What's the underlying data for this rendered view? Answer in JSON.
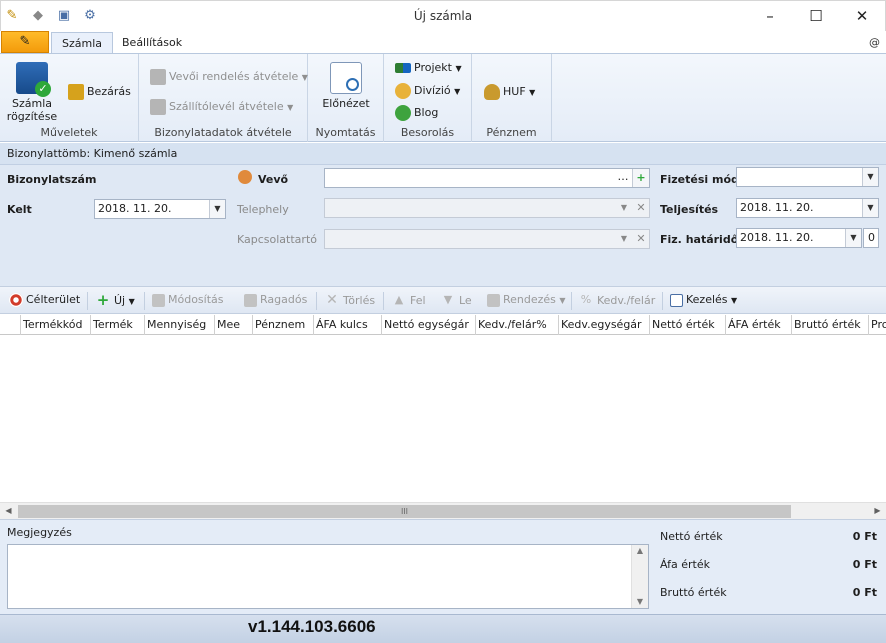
{
  "window": {
    "title": "Új számla",
    "quick_access_icons": [
      "save-icon",
      "undo-icon",
      "layout-icon",
      "settings-icon"
    ],
    "controls": [
      "–",
      "☐",
      "✕"
    ]
  },
  "ribbon_tabs": {
    "file_icon": "file-menu-icon",
    "tabs": [
      {
        "label": "Számla",
        "active": true
      },
      {
        "label": "Beállítások",
        "active": false
      }
    ],
    "help": "@"
  },
  "ribbon": {
    "groups": [
      {
        "label": "Műveletek",
        "buttons": [
          {
            "label_line1": "Számla",
            "label_line2": "rögzítése",
            "icon": "save-invoice-icon",
            "enabled": true
          },
          {
            "label": "Bezárás",
            "icon": "close-door-icon",
            "enabled": true
          }
        ]
      },
      {
        "label": "Bizonylatadatok átvétele",
        "buttons": [
          {
            "label": "Vevői rendelés átvétele",
            "icon": "order-icon",
            "enabled": false,
            "dropdown": true
          },
          {
            "label": "Szállítólevél átvétele",
            "icon": "delivery-note-icon",
            "enabled": false,
            "dropdown": true
          }
        ]
      },
      {
        "label": "Nyomtatás",
        "buttons": [
          {
            "label": "Előnézet",
            "icon": "print-preview-icon",
            "enabled": true
          }
        ]
      },
      {
        "label": "Besorolás",
        "buttons": [
          {
            "label": "Projekt",
            "icon": "project-icon",
            "enabled": true,
            "dropdown": true
          },
          {
            "label": "Divízió",
            "icon": "division-icon",
            "enabled": true,
            "dropdown": true
          },
          {
            "label": "Blog",
            "icon": "blog-icon",
            "enabled": true
          }
        ]
      },
      {
        "label": "Pénznem",
        "buttons": [
          {
            "label": "HUF",
            "icon": "money-bag-icon",
            "enabled": true,
            "dropdown": true
          }
        ]
      }
    ]
  },
  "info_strip": "Bizonylattömb: Kimenő számla",
  "form": {
    "bizonylatszam_label": "Bizonylatszám",
    "kelt_label": "Kelt",
    "kelt_value": "2018. 11. 20.",
    "vevo_label": "Vevő",
    "vevo_value": "",
    "telephely_label": "Telephely",
    "kapcsolattarto_label": "Kapcsolattartó",
    "fizetesi_mod_label": "Fizetési mód",
    "fizetesi_mod_value": "",
    "teljesites_label": "Teljesítés",
    "teljesites_value": "2018. 11. 20.",
    "fiz_hatarido_label": "Fiz. határidő",
    "fiz_hatarido_value": "2018. 11. 20.",
    "fiz_hatarido_days": "0"
  },
  "grid_toolbar": [
    {
      "label": "Célterület",
      "icon": "target-icon",
      "enabled": true
    },
    {
      "label": "Új",
      "icon": "add-icon",
      "enabled": true,
      "dropdown": true
    },
    {
      "label": "Módosítás",
      "icon": "edit-icon",
      "enabled": false
    },
    {
      "label": "Ragadós",
      "icon": "pin-icon",
      "enabled": false
    },
    {
      "label": "Törlés",
      "icon": "delete-icon",
      "enabled": false
    },
    {
      "label": "Fel",
      "icon": "arrow-up-icon",
      "enabled": false
    },
    {
      "label": "Le",
      "icon": "arrow-down-icon",
      "enabled": false
    },
    {
      "label": "Rendezés",
      "icon": "sort-icon",
      "enabled": false,
      "dropdown": true
    },
    {
      "label": "Kedv./felár",
      "icon": "discount-icon",
      "enabled": false
    },
    {
      "label": "Kezelés",
      "icon": "manage-icon",
      "enabled": true,
      "dropdown": true
    }
  ],
  "grid": {
    "columns": [
      "Termékkód",
      "Termék",
      "Mennyiség",
      "Mee",
      "Pénznem",
      "ÁFA kulcs",
      "Nettó egységár",
      "Kedv./felár%",
      "Kedv.egységár",
      "Nettó érték",
      "ÁFA érték",
      "Bruttó érték",
      "Pro"
    ],
    "rows": [],
    "scroll_grip": "III"
  },
  "bottom": {
    "megjegyzes_label": "Megjegyzés",
    "megjegyzes_value": "",
    "totals": [
      {
        "label": "Nettó érték",
        "value": "0 Ft"
      },
      {
        "label": "Áfa érték",
        "value": "0 Ft"
      },
      {
        "label": "Bruttó érték",
        "value": "0 Ft"
      }
    ]
  },
  "version": "v1.144.103.6606"
}
